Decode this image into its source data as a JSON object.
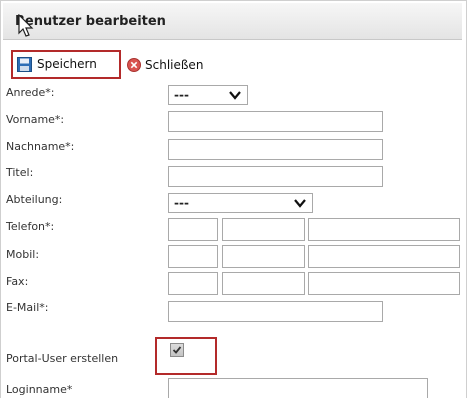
{
  "dialog": {
    "title": "Benutzer bearbeiten"
  },
  "toolbar": {
    "save_label": "Speichern",
    "close_label": "Schließen"
  },
  "form": {
    "anrede": {
      "label": "Anrede*:",
      "value": "---"
    },
    "vorname": {
      "label": "Vorname*:"
    },
    "nachname": {
      "label": "Nachname*:"
    },
    "titel": {
      "label": "Titel:"
    },
    "abteilung": {
      "label": "Abteilung:",
      "value": "---"
    },
    "telefon": {
      "label": "Telefon*:"
    },
    "mobil": {
      "label": "Mobil:"
    },
    "fax": {
      "label": "Fax:"
    },
    "email": {
      "label": "E-Mail*:"
    },
    "portal_user": {
      "label": "Portal-User erstellen",
      "checked": true
    },
    "loginname": {
      "label": "Loginname*"
    }
  },
  "colors": {
    "highlight": "#b32a2a",
    "save_icon": "#2d6db5",
    "close_icon": "#d9534f"
  }
}
